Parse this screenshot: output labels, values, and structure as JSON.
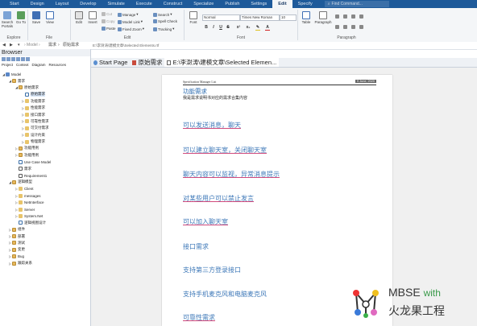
{
  "ribbon_tabs": [
    "Start",
    "Design",
    "Layout",
    "Develop",
    "Simulate",
    "Execute",
    "Construct",
    "Specialize",
    "Publish",
    "Settings",
    "Edit",
    "Specify"
  ],
  "active_tab": "Edit",
  "find_command": "Find Command...",
  "groups": {
    "explore": {
      "label": "Explore",
      "search_portals": "Search Portals",
      "go_to": "Go To"
    },
    "file": {
      "label": "File",
      "save": "Save",
      "view": "View"
    },
    "edit": {
      "label": "Edit",
      "edit": "Edit",
      "insert": "Insert",
      "cut": "Cut",
      "copy": "Copy",
      "paste": "Paste",
      "manage": "Manage",
      "model_link": "Model Link",
      "fixed_zoom": "Fixed Zoom",
      "search": "Search",
      "spell_check": "Spell Check",
      "tracking": "Tracking"
    },
    "font": {
      "label": "Font",
      "style": "Normal",
      "family": "Times New Roman",
      "size": "10",
      "font_button": "Font",
      "bold": "B",
      "italic": "I",
      "underline": "U",
      "strike": "S",
      "sup": "x²",
      "sub": "x₂",
      "color": "A"
    },
    "paragraph": {
      "label": "Paragraph",
      "table": "Table",
      "paragraph": "Paragraph"
    }
  },
  "path_bar": {
    "crumb1": "需求",
    "crumb2": "原始需求",
    "file_path": "E:\\李澍涛\\建模文章\\Selected Elements.rtf"
  },
  "browser": {
    "title": "Browser",
    "tabs": [
      "Project",
      "Context",
      "Diagram",
      "Resources"
    ],
    "tree": [
      {
        "label": "Model",
        "level": 0,
        "icon": "model",
        "exp": "◢"
      },
      {
        "label": "需求",
        "level": 1,
        "icon": "pkg",
        "exp": "◢"
      },
      {
        "label": "原始需求",
        "level": 2,
        "icon": "pkg",
        "exp": "◢"
      },
      {
        "label": "原始需求",
        "level": 3,
        "icon": "diag",
        "exp": "",
        "selected": true
      },
      {
        "label": "功能需求",
        "level": 3,
        "icon": "folder",
        "exp": "▷"
      },
      {
        "label": "性能需求",
        "level": 3,
        "icon": "folder",
        "exp": "▷"
      },
      {
        "label": "接口需求",
        "level": 3,
        "icon": "folder",
        "exp": "▷"
      },
      {
        "label": "可靠性需求",
        "level": 3,
        "icon": "folder",
        "exp": "▷"
      },
      {
        "label": "可交付需求",
        "level": 3,
        "icon": "folder",
        "exp": "▷"
      },
      {
        "label": "设计约束",
        "level": 3,
        "icon": "folder",
        "exp": "▷"
      },
      {
        "label": "物理需求",
        "level": 3,
        "icon": "folder",
        "exp": "▷"
      },
      {
        "label": "功能用例",
        "level": 2,
        "icon": "pkg",
        "exp": "▷"
      },
      {
        "label": "功能用例",
        "level": 2,
        "icon": "pkg",
        "exp": "▷"
      },
      {
        "label": "Use Case Model",
        "level": 2,
        "icon": "diag",
        "exp": ""
      },
      {
        "label": "需求",
        "level": 2,
        "icon": "req",
        "exp": ""
      },
      {
        "label": "Requirement1",
        "level": 2,
        "icon": "req",
        "exp": ""
      },
      {
        "label": "逻辑模型",
        "level": 1,
        "icon": "pkg",
        "exp": "◢"
      },
      {
        "label": "Client",
        "level": 2,
        "icon": "folder",
        "exp": "▷"
      },
      {
        "label": "messages",
        "level": 2,
        "icon": "folder",
        "exp": "▷"
      },
      {
        "label": "NetInterface",
        "level": 2,
        "icon": "folder",
        "exp": "▷"
      },
      {
        "label": "Server",
        "level": 2,
        "icon": "folder",
        "exp": "▷"
      },
      {
        "label": "System.Net",
        "level": 2,
        "icon": "folder",
        "exp": "▷"
      },
      {
        "label": "逻辑视图设计",
        "level": 2,
        "icon": "diag",
        "exp": ""
      },
      {
        "label": "组件",
        "level": 1,
        "icon": "pkg",
        "exp": "▷"
      },
      {
        "label": "部署",
        "level": 1,
        "icon": "pkg",
        "exp": "▷"
      },
      {
        "label": "测试",
        "level": 1,
        "icon": "pkg",
        "exp": "▷"
      },
      {
        "label": "变更",
        "level": 1,
        "icon": "pkg",
        "exp": "▷"
      },
      {
        "label": "Bug",
        "level": 1,
        "icon": "pkg",
        "exp": "▷"
      },
      {
        "label": "跟踪关系",
        "level": 1,
        "icon": "pkg",
        "exp": "▷"
      }
    ]
  },
  "editor_tabs": {
    "start": "Start Page",
    "req": "原始需求",
    "file": "E:\\李澍涛\\建模文章\\Selected Elemen..."
  },
  "document": {
    "header_left": "Specification Manager List",
    "header_right": "9 June, 2020",
    "title": "功能需求",
    "subtitle": "我是需求说明书对应的需求合集内容",
    "sections": [
      {
        "text": "可以发送消息，聊天",
        "ul": true
      },
      {
        "text": "可以建立聊天室，关闭聊天室",
        "ul": true
      },
      {
        "text": "聊天内容可以监视，异常消息提示",
        "ul": true
      },
      {
        "text": "对某些用户可以禁止发言",
        "ul": true
      },
      {
        "text": "可以加入聊天室",
        "ul": true
      },
      {
        "text": "接口需求",
        "ul": false
      },
      {
        "text": "支持第三方登录接口",
        "ul": false
      },
      {
        "text": "支持手机麦克风和电脑麦克风",
        "ul": false
      },
      {
        "text": "可靠性需求",
        "ul": true
      }
    ]
  },
  "watermark": {
    "line1": "MBSE",
    "line1b": "with",
    "line2": "火龙果工程"
  }
}
